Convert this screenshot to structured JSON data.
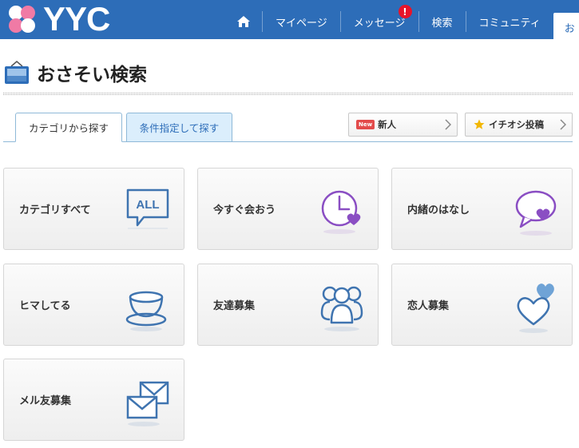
{
  "header": {
    "logo_text": "YYC",
    "nav": [
      {
        "label": "マイページ"
      },
      {
        "label": "メッセージ",
        "badge": "!"
      },
      {
        "label": "検索"
      },
      {
        "label": "コミュニティ"
      },
      {
        "label": "お"
      }
    ]
  },
  "page": {
    "title": "おさそい検索"
  },
  "tabs": [
    {
      "label": "カテゴリから探す",
      "active": true
    },
    {
      "label": "条件指定して探す",
      "active": false
    }
  ],
  "quick_links": {
    "new": {
      "chip": "New",
      "label": "新人"
    },
    "pick": {
      "label": "イチオシ投稿"
    }
  },
  "categories": [
    {
      "label": "カテゴリすべて",
      "icon": "all-speech-bubble-icon"
    },
    {
      "label": "今すぐ会おう",
      "icon": "clock-heart-icon"
    },
    {
      "label": "内緒のはなし",
      "icon": "speech-bubble-heart-icon"
    },
    {
      "label": "ヒマしてる",
      "icon": "teacup-icon"
    },
    {
      "label": "友達募集",
      "icon": "friends-icon"
    },
    {
      "label": "恋人募集",
      "icon": "hearts-icon"
    },
    {
      "label": "メル友募集",
      "icon": "envelopes-icon"
    }
  ],
  "colors": {
    "brand": "#2d6db8",
    "icon_blue": "#3f74b0",
    "icon_purple": "#8a4ec3",
    "badge": "#e8142a"
  }
}
